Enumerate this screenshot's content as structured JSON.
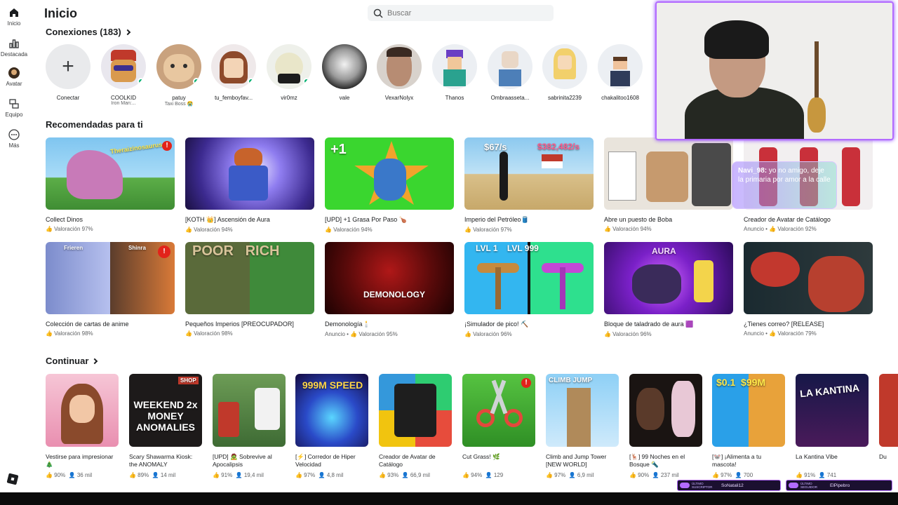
{
  "sidebar": {
    "items": [
      {
        "label": "Inicio",
        "icon": "home-icon"
      },
      {
        "label": "Destacada",
        "icon": "chart-icon"
      },
      {
        "label": "Avatar",
        "icon": "avatar-icon"
      },
      {
        "label": "Equipo",
        "icon": "team-icon"
      },
      {
        "label": "Más",
        "icon": "more-icon"
      }
    ]
  },
  "header": {
    "title": "Inicio",
    "search_placeholder": "Buscar"
  },
  "connections": {
    "title": "Conexiones (183)",
    "add_label": "Conectar",
    "friends": [
      {
        "name": "COOLKID",
        "status": "Iron Man:..."
      },
      {
        "name": "patuy",
        "status": "Taxi Boss 😭"
      },
      {
        "name": "tu_femboyfav...",
        "status": ""
      },
      {
        "name": "vir0mz",
        "status": ""
      },
      {
        "name": "vale",
        "status": ""
      },
      {
        "name": "VexarNolyx",
        "status": ""
      },
      {
        "name": "Thanos",
        "status": ""
      },
      {
        "name": "Ombraasseta...",
        "status": ""
      },
      {
        "name": "sabrinita2239",
        "status": ""
      },
      {
        "name": "chakalitoo1608",
        "status": ""
      }
    ]
  },
  "recommended": {
    "title": "Recomendadas para ti",
    "games": [
      {
        "title": "Collect Dinos",
        "meta": "👍 Valoración 97%",
        "thumb_text": "Theraizinosaurus"
      },
      {
        "title": "[KOTH 👑] Ascensión de Aura",
        "meta": "👍 Valoración 94%",
        "thumb_text": ""
      },
      {
        "title": "[UPD] +1 Grasa Por Paso 🍗",
        "meta": "👍 Valoración 94%",
        "thumb_text": "+1"
      },
      {
        "title": "Imperio del Petróleo🛢️",
        "meta": "👍 Valoración 97%",
        "thumb_text": "$67/s"
      },
      {
        "title": "Abre un puesto de Boba",
        "meta": "👍 Valoración 94%",
        "thumb_text": ""
      },
      {
        "title": "Creador de Avatar de Catálogo",
        "meta": "Anuncio • 👍 Valoración 92%",
        "thumb_text": ""
      },
      {
        "title": "Colección de cartas de anime",
        "meta": "👍 Valoración 98%",
        "thumb_text": "Frieren"
      },
      {
        "title": "Pequeños Imperios [PREOCUPADOR]",
        "meta": "👍 Valoración 98%",
        "thumb_text": "POOR   RICH"
      },
      {
        "title": "Demonología🕯️",
        "meta": "Anuncio • 👍 Valoración 95%",
        "thumb_text": "DEMONOLOGY"
      },
      {
        "title": "¡Simulador de pico! ⛏️",
        "meta": "👍 Valoración 96%",
        "thumb_text": "LVL 1    LVL 999"
      },
      {
        "title": "Bloque de taladrado de aura 🟪",
        "meta": "👍 Valoración 96%",
        "thumb_text": "AURA"
      },
      {
        "title": "¿Tienes correo? [RELEASE]",
        "meta": "Anuncio • 👍 Valoración 79%",
        "thumb_text": ""
      }
    ]
  },
  "continue": {
    "title": "Continuar",
    "games": [
      {
        "title": "Vestirse para impresionar🎄",
        "rating": "👍 90%",
        "players": "👤 36 mil",
        "thumb_text": ""
      },
      {
        "title": "Scary Shawarma Kiosk: the ANOMALY",
        "rating": "👍 89%",
        "players": "👤 14 mil",
        "thumb_text": "WEEKEND 2x MONEY ANOMALIES"
      },
      {
        "title": "[UPD] 🧟 Sobrevive al Apocalipsis",
        "rating": "👍 91%",
        "players": "👤 19,4 mil",
        "thumb_text": ""
      },
      {
        "title": "[⚡] Corredor de Hiper Velocidad",
        "rating": "👍 97%",
        "players": "👤 4,8 mil",
        "thumb_text": "999M SPEED"
      },
      {
        "title": "Creador de Avatar de Catálogo",
        "rating": "👍 93%",
        "players": "👤 66,9 mil",
        "thumb_text": ""
      },
      {
        "title": "Cut Grass! 🌿",
        "rating": "👍 94%",
        "players": "👤 129",
        "thumb_text": ""
      },
      {
        "title": "Climb and Jump Tower [NEW WORLD]",
        "rating": "👍 97%",
        "players": "👤 6,9 mil",
        "thumb_text": "CLIMB JUMP"
      },
      {
        "title": "[🦌] 99 Noches en el Bosque 🔦",
        "rating": "👍 90%",
        "players": "👤 237 mil",
        "thumb_text": ""
      },
      {
        "title": "[🐭] ¡Alimenta a tu mascota!",
        "rating": "👍 97%",
        "players": "👤 700",
        "thumb_text": "$0.1  $99M"
      },
      {
        "title": "La Kantina Vibe",
        "rating": "👍 91%",
        "players": "👤 741",
        "thumb_text": "LA KANTINA"
      },
      {
        "title": "Du",
        "rating": "",
        "players": "",
        "thumb_text": ""
      }
    ]
  },
  "stream": {
    "chat_user": "Navi_98:",
    "chat_message": "yo no amigo, deje la primaria por amor a la calle",
    "tag1_caption": "ÚLTIMO SUSCRIPTOR",
    "tag1_value": "SoNatali12",
    "tag2_caption": "ÚLTIMO SEGUIDOR",
    "tag2_value": "ElPipebro"
  }
}
